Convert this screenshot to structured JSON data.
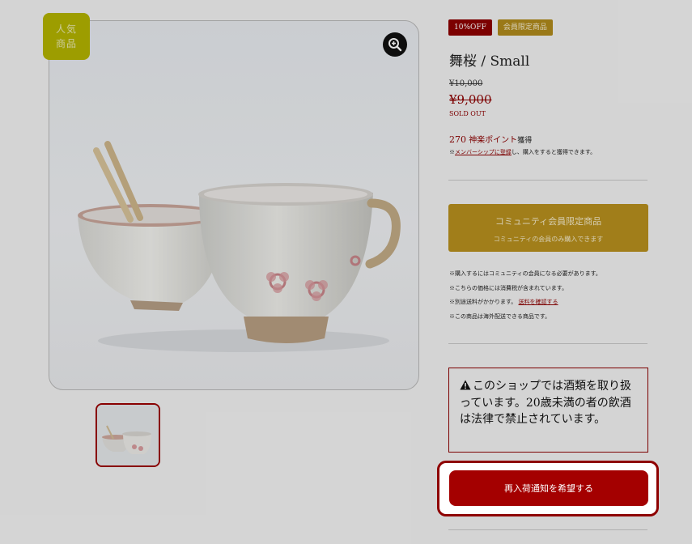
{
  "gallery": {
    "popular_badge_line1": "人気",
    "popular_badge_line2": "商品",
    "zoom_icon": "zoom-in-icon",
    "main_image_alt": "舞桜 cups",
    "thumbnail_alt": "舞桜 thumbnail"
  },
  "product": {
    "badges": [
      "10%OFF",
      "会員限定商品"
    ],
    "title": "舞桜 / Small",
    "original_price": "¥10,000",
    "sale_price": "¥9,000",
    "stock_status": "SOLD OUT",
    "points_value": "270",
    "points_label": "神楽ポイント",
    "points_suffix": "獲得",
    "member_note_prefix": "※",
    "member_note_link": "メンバーシップに登録",
    "member_note_suffix": "し、購入をすると獲得できます。"
  },
  "community": {
    "title": "コミュニティ会員限定商品",
    "subtitle": "コミュニティの会員のみ購入できます"
  },
  "notes": {
    "line1": "※購入するにはコミュニティの会員になる必要があります。",
    "line2": "※こちらの価格には消費税が含まれています。",
    "line3_prefix": "※別途送料がかかります。",
    "line3_link": "送料を確認する",
    "line4": "※この商品は海外配送できる商品です。"
  },
  "warning": {
    "icon": "warning-icon",
    "text": "このショップでは酒類を取り扱っています。20歳未満の者の飲酒は法律で禁止されています。"
  },
  "restock": {
    "label": "再入荷通知を希望する"
  },
  "colors": {
    "accent_red": "#8e0000",
    "button_red": "#a40000",
    "gold": "#b8901e",
    "popular_badge": "#b3b300"
  }
}
